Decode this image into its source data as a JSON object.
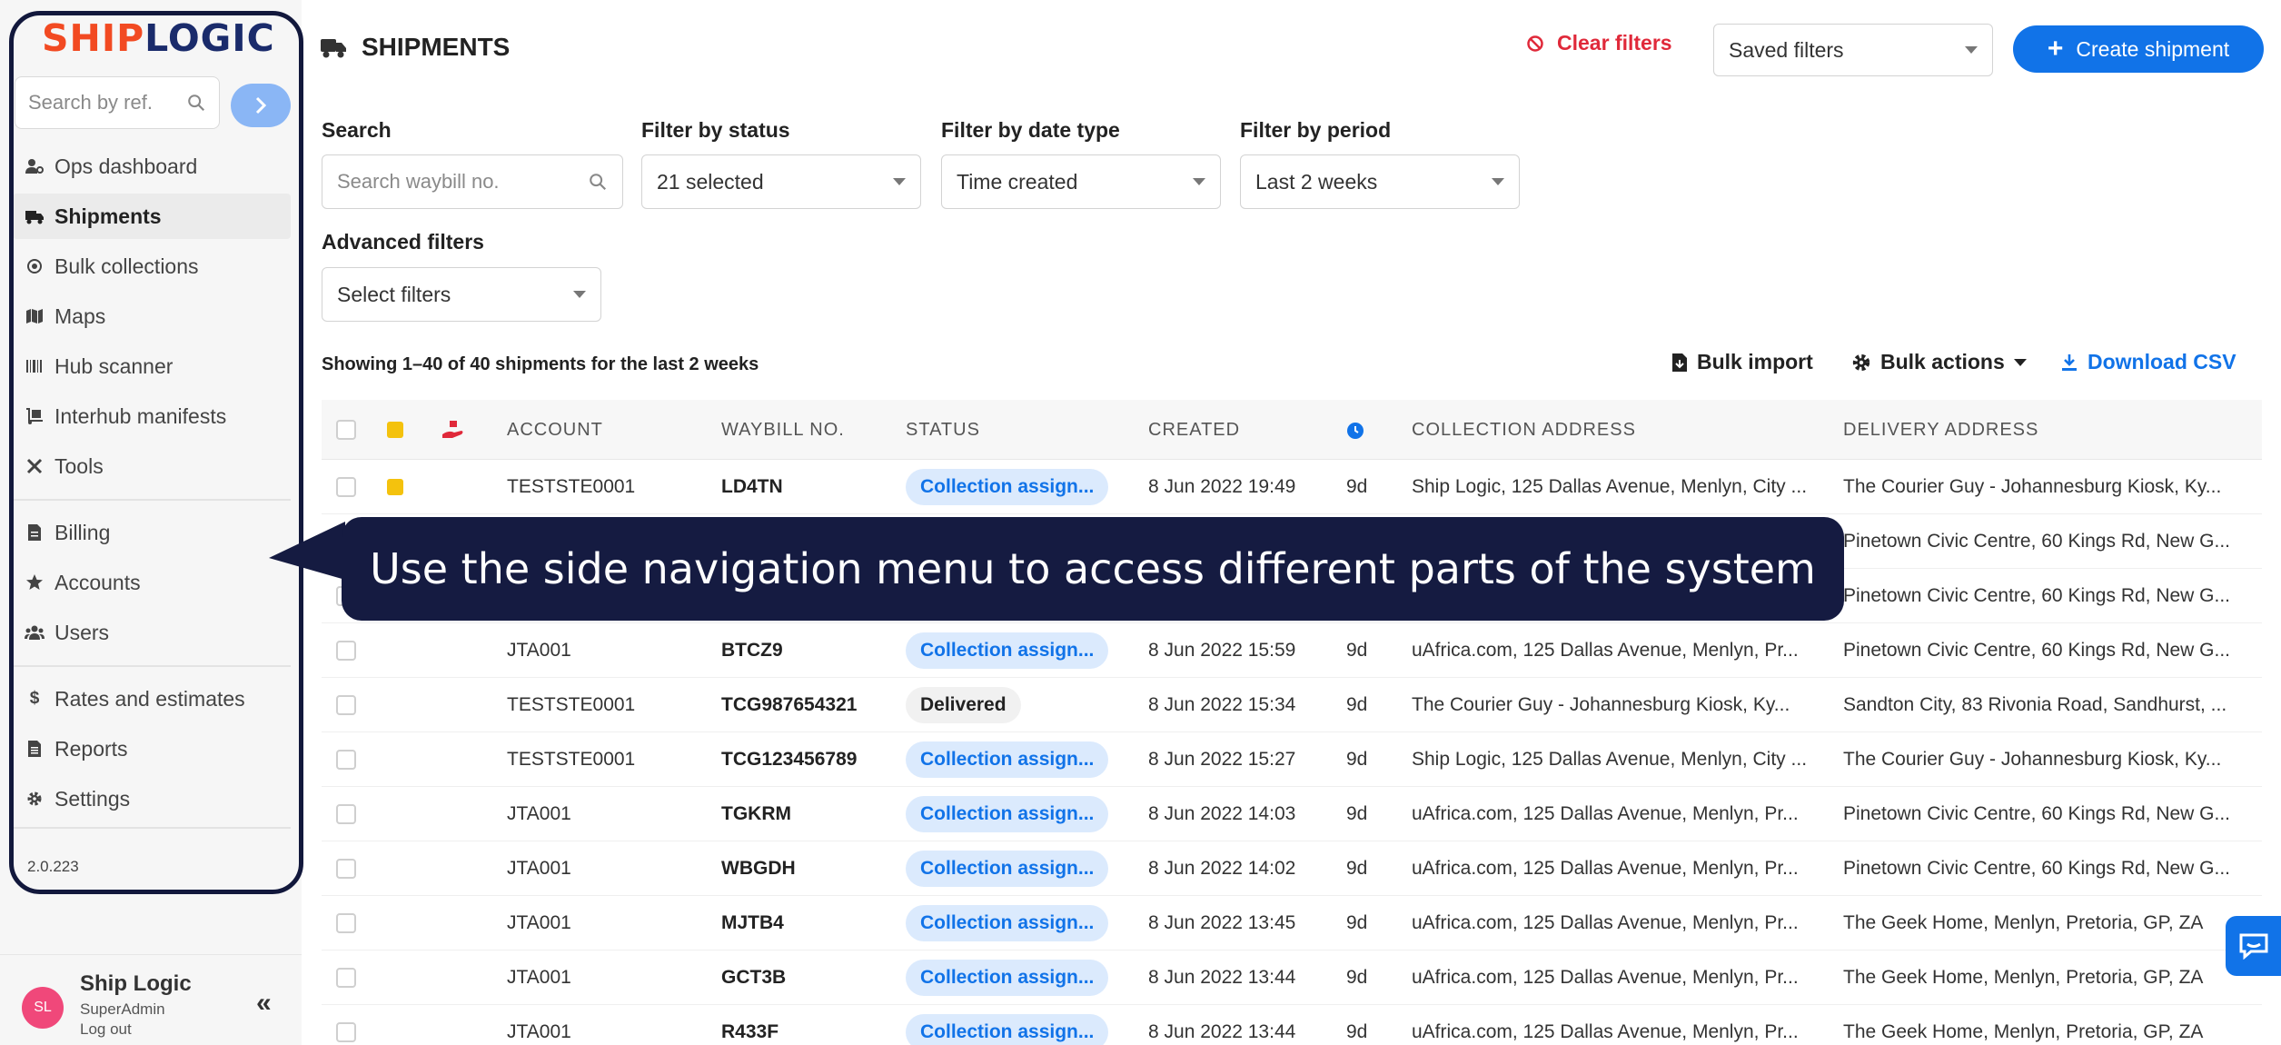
{
  "brand": {
    "logo_part1": "SHIP",
    "logo_part2": "LOGIC",
    "accent": "#f24a22",
    "primary": "#1173e8"
  },
  "sidebar": {
    "search_placeholder": "Search by ref.",
    "items": [
      {
        "label": "Ops dashboard",
        "icon": "user-gear-icon"
      },
      {
        "label": "Shipments",
        "icon": "truck-icon",
        "active": true
      },
      {
        "label": "Bulk collections",
        "icon": "target-icon"
      },
      {
        "label": "Maps",
        "icon": "map-icon"
      },
      {
        "label": "Hub scanner",
        "icon": "barcode-icon"
      },
      {
        "label": "Interhub manifests",
        "icon": "dolly-icon"
      },
      {
        "label": "Tools",
        "icon": "tools-icon"
      },
      {
        "label": "Billing",
        "icon": "invoice-icon"
      },
      {
        "label": "Accounts",
        "icon": "star-icon"
      },
      {
        "label": "Users",
        "icon": "users-icon"
      },
      {
        "label": "Rates and estimates",
        "icon": "dollar-icon"
      },
      {
        "label": "Reports",
        "icon": "report-icon"
      },
      {
        "label": "Settings",
        "icon": "gear-icon"
      }
    ],
    "version": "2.0.223",
    "user": {
      "initials": "SL",
      "name": "Ship Logic",
      "role": "SuperAdmin",
      "logout": "Log out"
    }
  },
  "header": {
    "title": "SHIPMENTS",
    "clear_filters": "Clear filters",
    "saved_filters": "Saved filters",
    "create_shipment": "Create shipment"
  },
  "filters": {
    "search_label": "Search",
    "search_placeholder": "Search waybill no.",
    "status_label": "Filter by status",
    "status_value": "21 selected",
    "date_type_label": "Filter by date type",
    "date_type_value": "Time created",
    "period_label": "Filter by period",
    "period_value": "Last 2 weeks",
    "advanced_label": "Advanced filters",
    "advanced_value": "Select filters"
  },
  "results": {
    "summary": "Showing 1–40 of 40 shipments for the last 2 weeks",
    "bulk_import": "Bulk import",
    "bulk_actions": "Bulk actions",
    "download_csv": "Download CSV"
  },
  "table": {
    "columns": [
      "ACCOUNT",
      "WAYBILL NO.",
      "STATUS",
      "CREATED",
      "COLLECTION ADDRESS",
      "DELIVERY ADDRESS"
    ],
    "rows": [
      {
        "account": "TESTSTE0001",
        "waybill": "LD4TN",
        "status": "Collection assign...",
        "status_kind": "blue",
        "created": "8 Jun 2022 19:49",
        "age": "9d",
        "collection": "Ship Logic, 125 Dallas Avenue, Menlyn, City ...",
        "delivery": "The Courier Guy - Johannesburg Kiosk, Ky...",
        "note": true
      },
      {
        "account": "",
        "waybill": "",
        "status": "",
        "status_kind": "",
        "created": "",
        "age": "",
        "collection": "",
        "delivery": "Pinetown Civic Centre, 60 Kings Rd, New G..."
      },
      {
        "account": "",
        "waybill": "",
        "status": "",
        "status_kind": "",
        "created": "",
        "age": "",
        "collection": "",
        "delivery": "Pinetown Civic Centre, 60 Kings Rd, New G..."
      },
      {
        "account": "JTA001",
        "waybill": "BTCZ9",
        "status": "Collection assign...",
        "status_kind": "blue",
        "created": "8 Jun 2022 15:59",
        "age": "9d",
        "collection": "uAfrica.com, 125 Dallas Avenue, Menlyn, Pr...",
        "delivery": "Pinetown Civic Centre, 60 Kings Rd, New G..."
      },
      {
        "account": "TESTSTE0001",
        "waybill": "TCG987654321",
        "status": "Delivered",
        "status_kind": "grey",
        "created": "8 Jun 2022 15:34",
        "age": "9d",
        "collection": "The Courier Guy - Johannesburg Kiosk, Ky...",
        "delivery": "Sandton City, 83 Rivonia Road, Sandhurst, ..."
      },
      {
        "account": "TESTSTE0001",
        "waybill": "TCG123456789",
        "status": "Collection assign...",
        "status_kind": "blue",
        "created": "8 Jun 2022 15:27",
        "age": "9d",
        "collection": "Ship Logic, 125 Dallas Avenue, Menlyn, City ...",
        "delivery": "The Courier Guy - Johannesburg Kiosk, Ky..."
      },
      {
        "account": "JTA001",
        "waybill": "TGKRM",
        "status": "Collection assign...",
        "status_kind": "blue",
        "created": "8 Jun 2022 14:03",
        "age": "9d",
        "collection": "uAfrica.com, 125 Dallas Avenue, Menlyn, Pr...",
        "delivery": "Pinetown Civic Centre, 60 Kings Rd, New G..."
      },
      {
        "account": "JTA001",
        "waybill": "WBGDH",
        "status": "Collection assign...",
        "status_kind": "blue",
        "created": "8 Jun 2022 14:02",
        "age": "9d",
        "collection": "uAfrica.com, 125 Dallas Avenue, Menlyn, Pr...",
        "delivery": "Pinetown Civic Centre, 60 Kings Rd, New G..."
      },
      {
        "account": "JTA001",
        "waybill": "MJTB4",
        "status": "Collection assign...",
        "status_kind": "blue",
        "created": "8 Jun 2022 13:45",
        "age": "9d",
        "collection": "uAfrica.com, 125 Dallas Avenue, Menlyn, Pr...",
        "delivery": "The Geek Home, Menlyn, Pretoria, GP, ZA"
      },
      {
        "account": "JTA001",
        "waybill": "GCT3B",
        "status": "Collection assign...",
        "status_kind": "blue",
        "created": "8 Jun 2022 13:44",
        "age": "9d",
        "collection": "uAfrica.com, 125 Dallas Avenue, Menlyn, Pr...",
        "delivery": "The Geek Home, Menlyn, Pretoria, GP, ZA"
      },
      {
        "account": "JTA001",
        "waybill": "R433F",
        "status": "Collection assign...",
        "status_kind": "blue",
        "created": "8 Jun 2022 13:44",
        "age": "9d",
        "collection": "uAfrica.com, 125 Dallas Avenue, Menlyn, Pr...",
        "delivery": "The Geek Home, Menlyn, Pretoria, GP, ZA"
      }
    ]
  },
  "callout": {
    "text": "Use the side navigation menu to access different parts of the system"
  }
}
